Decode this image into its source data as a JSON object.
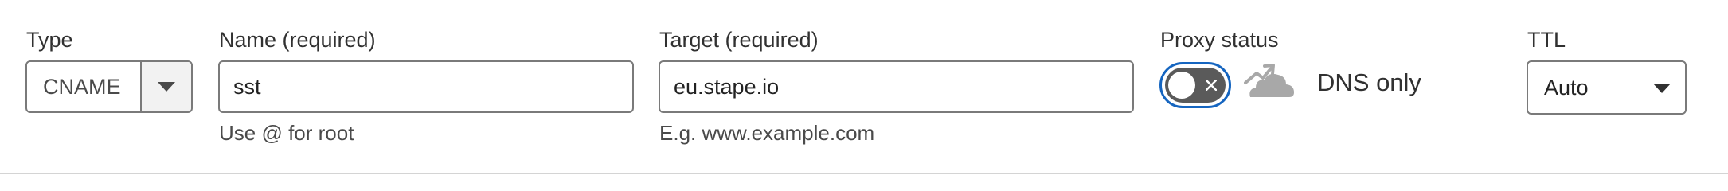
{
  "record": {
    "type": {
      "label": "Type",
      "value": "CNAME"
    },
    "name": {
      "label": "Name (required)",
      "value": "sst",
      "help": "Use @ for root"
    },
    "target": {
      "label": "Target (required)",
      "value": "eu.stape.io",
      "help": "E.g. www.example.com"
    },
    "proxy": {
      "label": "Proxy status",
      "state_text": "DNS only",
      "toggle_icon": "close-icon",
      "cloud_icon": "cloud-bypass-icon"
    },
    "ttl": {
      "label": "TTL",
      "value": "Auto"
    }
  },
  "colors": {
    "toggle_track": "#5a5a5a",
    "focus_ring": "#1565c0",
    "cloud": "#a8a8a8",
    "border": "#7a7a7a"
  }
}
